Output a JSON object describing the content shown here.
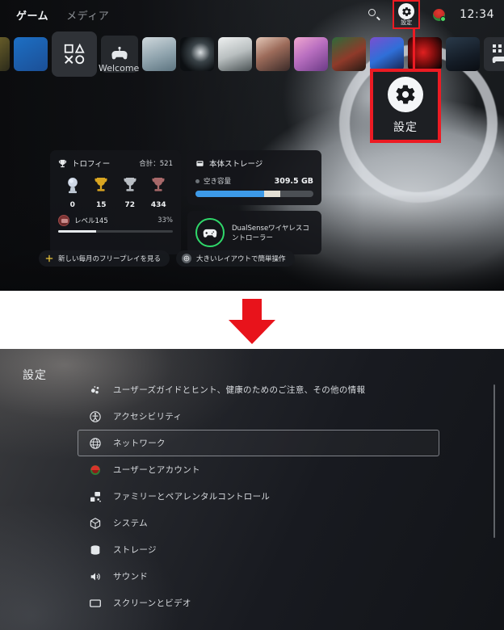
{
  "home": {
    "tabs": [
      {
        "label": "ゲーム",
        "active": true
      },
      {
        "label": "メディア",
        "active": false
      }
    ],
    "status": {
      "search_icon": "search-icon",
      "settings_icon": "gear-icon",
      "settings_label": "設定",
      "avatar_icon": "avatar-icon",
      "clock": "12:34"
    },
    "callout": {
      "icon": "gear-icon",
      "label": "設定",
      "border_color": "#ec1b23"
    },
    "tiles": {
      "welcome_label": "Welcome",
      "items": [
        {
          "name": "tile-partial-left",
          "kind": "clipped"
        },
        {
          "name": "tile-playstation-store",
          "kind": "store"
        },
        {
          "name": "tile-ps-shapes",
          "kind": "big"
        },
        {
          "name": "tile-welcome-controller",
          "kind": "ctrl"
        },
        {
          "name": "tile-final-fantasy",
          "kind": "art-ff"
        },
        {
          "name": "tile-dark-game",
          "kind": "art-dark"
        },
        {
          "name": "tile-white-statue",
          "kind": "art-white"
        },
        {
          "name": "tile-group-photo",
          "kind": "art-people"
        },
        {
          "name": "tile-anime-pink",
          "kind": "art-pink"
        },
        {
          "name": "tile-action-red",
          "kind": "art-action"
        },
        {
          "name": "tile-vr-game",
          "kind": "art-vr"
        },
        {
          "name": "tile-persona",
          "kind": "art-persona"
        },
        {
          "name": "tile-dark-blue",
          "kind": "art-blue"
        },
        {
          "name": "tile-game-library",
          "kind": "library"
        }
      ]
    },
    "trophy_card": {
      "icon": "trophy-icon",
      "title": "トロフィー",
      "total_label": "合計：521",
      "tiers": [
        {
          "name": "platinum",
          "count": "0",
          "color": "#cfd8e6"
        },
        {
          "name": "gold",
          "count": "15",
          "color": "#d9a521"
        },
        {
          "name": "silver",
          "count": "72",
          "color": "#b9bec4"
        },
        {
          "name": "bronze",
          "count": "434",
          "color": "#a8696a"
        }
      ],
      "level_label": "レベル145",
      "level_percent": "33%",
      "level_fill": 33
    },
    "storage_card": {
      "icon": "storage-icon",
      "title": "本体ストレージ",
      "free_label": "空き容量",
      "free_value": "309.5 GB",
      "used_percent": 58,
      "other_percent": 14,
      "used_color": "#3d9ae8"
    },
    "controller_card": {
      "icon": "controller-icon",
      "name": "DualSenseワイヤレスコントローラー",
      "ring_color": "#2fd86a"
    },
    "pills": [
      {
        "icon": "ps-plus-icon",
        "label": "新しい毎月のフリープレイを見る"
      },
      {
        "icon": "layout-icon",
        "label": "大きいレイアウトで簡単操作"
      }
    ]
  },
  "arrow": {
    "name": "down-arrow",
    "color": "#e8131b"
  },
  "settings_page": {
    "title": "設定",
    "items": [
      {
        "icon": "user-guide-icon",
        "label": "ユーザーズガイドとヒント、健康のためのご注意、その他の情報",
        "selected": false
      },
      {
        "icon": "accessibility-icon",
        "label": "アクセシビリティ",
        "selected": false
      },
      {
        "icon": "network-icon",
        "label": "ネットワーク",
        "selected": true
      },
      {
        "icon": "user-account-icon",
        "label": "ユーザーとアカウント",
        "selected": false
      },
      {
        "icon": "family-controls-icon",
        "label": "ファミリーとペアレンタルコントロール",
        "selected": false
      },
      {
        "icon": "system-icon",
        "label": "システム",
        "selected": false
      },
      {
        "icon": "storage-icon",
        "label": "ストレージ",
        "selected": false
      },
      {
        "icon": "sound-icon",
        "label": "サウンド",
        "selected": false
      },
      {
        "icon": "screen-video-icon",
        "label": "スクリーンとビデオ",
        "selected": false
      }
    ]
  }
}
